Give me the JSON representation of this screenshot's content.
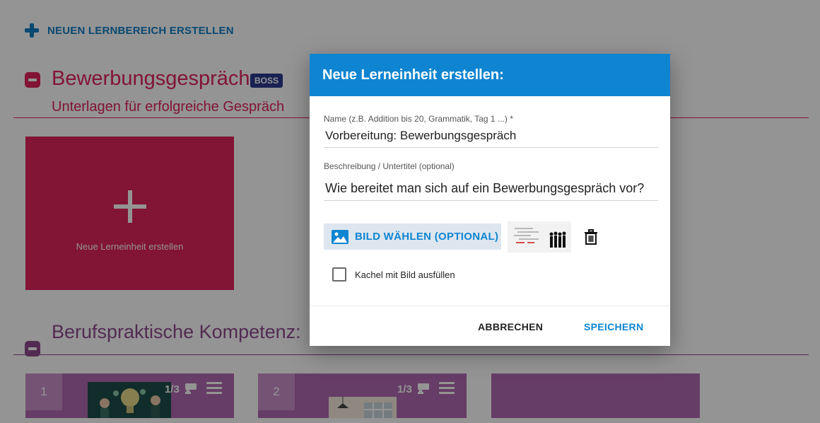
{
  "app": {
    "new_area_label": "NEUEN LERNBEREICH ERSTELLEN"
  },
  "sections": [
    {
      "title": "Bewerbungsgespräch",
      "badge": "BOSS",
      "subtitle": "Unterlagen für erfolgreiche Gespräch",
      "new_tile_label": "Neue Lerneinheit erstellen"
    },
    {
      "title": "Berufspraktische Kompetenz:"
    }
  ],
  "units": [
    {
      "number": "1",
      "progress": "1/3"
    },
    {
      "number": "2",
      "progress": "1/3"
    }
  ],
  "dialog": {
    "title": "Neue Lerneinheit erstellen:",
    "name_label": "Name (z.B. Addition bis 20, Grammatik, Tag 1 ...) *",
    "name_value": "Vorbereitung: Bewerbungsgespräch",
    "description_label": "Beschreibung / Untertitel (optional)",
    "description_value": "Wie bereitet man sich auf ein Bewerbungsgespräch vor?",
    "image_button_label": "BILD WÄHLEN (OPTIONAL)",
    "checkbox_label": "Kachel mit Bild ausfüllen",
    "checkbox_checked": false,
    "cancel_label": "ABBRECHEN",
    "save_label": "SPEICHERN"
  },
  "colors": {
    "primary_blue": "#0f85d1",
    "section_red": "#e0245e",
    "section_purple": "#8e4a8e",
    "badge_navy": "#2c3b8f"
  },
  "icons": [
    "plus-icon",
    "minus-icon",
    "image-icon",
    "trash-icon",
    "teacher-icon",
    "menu-icon"
  ]
}
